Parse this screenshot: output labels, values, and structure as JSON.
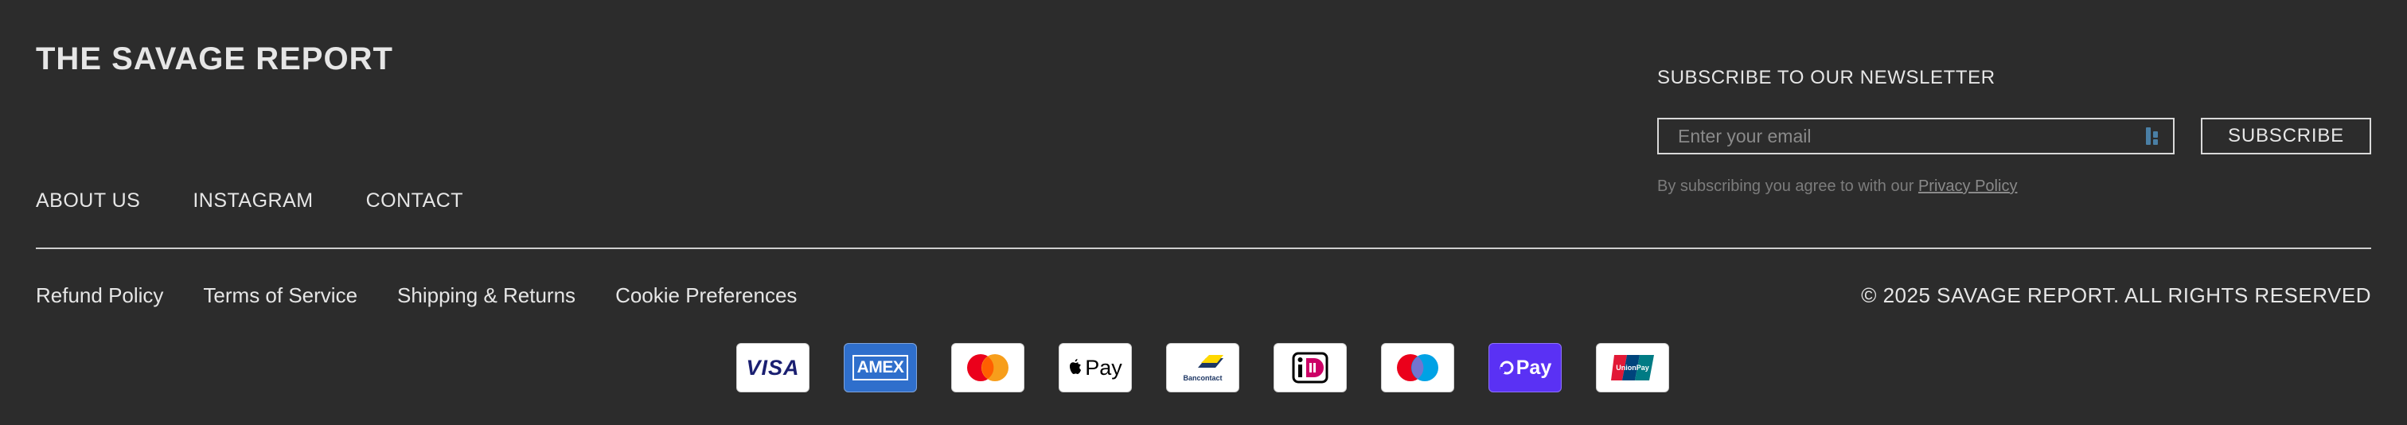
{
  "brand": {
    "name": "THE SAVAGE REPORT"
  },
  "nav": [
    {
      "label": "ABOUT US"
    },
    {
      "label": "INSTAGRAM"
    },
    {
      "label": "CONTACT"
    }
  ],
  "newsletter": {
    "title": "SUBSCRIBE TO OUR NEWSLETTER",
    "placeholder": "Enter your email",
    "button": "SUBSCRIBE",
    "consent_text": "By subscribing you agree to with our",
    "consent_link": "Privacy Policy"
  },
  "legal": [
    {
      "label": "Refund Policy"
    },
    {
      "label": "Terms of Service"
    },
    {
      "label": "Shipping & Returns"
    },
    {
      "label": "Cookie Preferences"
    }
  ],
  "copyright": "© 2025 SAVAGE REPORT. ALL RIGHTS RESERVED",
  "payments": [
    {
      "name": "visa-icon",
      "label": "VISA"
    },
    {
      "name": "amex-icon",
      "label": "AMEX"
    },
    {
      "name": "mastercard-icon"
    },
    {
      "name": "apple-pay-icon",
      "label": "Pay"
    },
    {
      "name": "bancontact-icon",
      "label": "Bancontact"
    },
    {
      "name": "ideal-icon"
    },
    {
      "name": "maestro-icon"
    },
    {
      "name": "shop-pay-icon",
      "label": "Pay"
    },
    {
      "name": "unionpay-icon",
      "label": "UnionPay"
    }
  ],
  "colors": {
    "background": "#2c2c2c",
    "text": "#e6e6e6",
    "amex": "#2f6fcc",
    "shop_pay": "#5a31f4"
  }
}
